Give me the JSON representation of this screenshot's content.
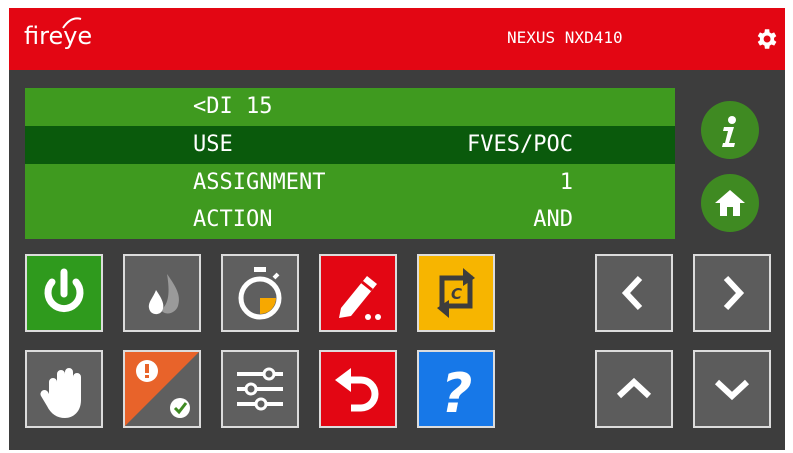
{
  "header": {
    "logo_text": "fireye",
    "model": "NEXUS NXD410",
    "settings_icon": "gear-icon",
    "color": "#e30613"
  },
  "display": {
    "rows": [
      {
        "label": "<DI 15",
        "value": "",
        "selected": false
      },
      {
        "label": "USE",
        "value": "FVES/POC",
        "selected": true
      },
      {
        "label": "ASSIGNMENT",
        "value": "1",
        "selected": false
      },
      {
        "label": "ACTION",
        "value": "AND",
        "selected": false
      }
    ],
    "row_color": "#3f9a1f",
    "selected_color": "#0a5a0c"
  },
  "side_buttons": [
    {
      "name": "info",
      "icon": "info-icon"
    },
    {
      "name": "home",
      "icon": "home-icon"
    }
  ],
  "tiles": [
    {
      "name": "power",
      "icon": "power-icon",
      "color": "#2f9a1d"
    },
    {
      "name": "flame",
      "icon": "flame-icon",
      "color": "#5f5f5f"
    },
    {
      "name": "timer",
      "icon": "stopwatch-icon",
      "color": "#5f5f5f"
    },
    {
      "name": "edit",
      "icon": "pencil-icon",
      "color": "#e30613"
    },
    {
      "name": "cycle",
      "icon": "cycle-icon",
      "color": "#f7b500",
      "glyph": "C"
    },
    {
      "name": "hold",
      "icon": "hand-icon",
      "color": "#5f5f5f"
    },
    {
      "name": "alarm",
      "icon": "alarm-check-icon",
      "color": "#e8632a"
    },
    {
      "name": "adjust",
      "icon": "sliders-icon",
      "color": "#5f5f5f"
    },
    {
      "name": "undo",
      "icon": "undo-icon",
      "color": "#e30613"
    },
    {
      "name": "help",
      "icon": "help-icon",
      "color": "#1778e8",
      "glyph": "?"
    }
  ],
  "nav_buttons": [
    {
      "name": "left",
      "icon": "chevron-left-icon"
    },
    {
      "name": "right",
      "icon": "chevron-right-icon"
    },
    {
      "name": "up",
      "icon": "chevron-up-icon"
    },
    {
      "name": "down",
      "icon": "chevron-down-icon"
    }
  ]
}
